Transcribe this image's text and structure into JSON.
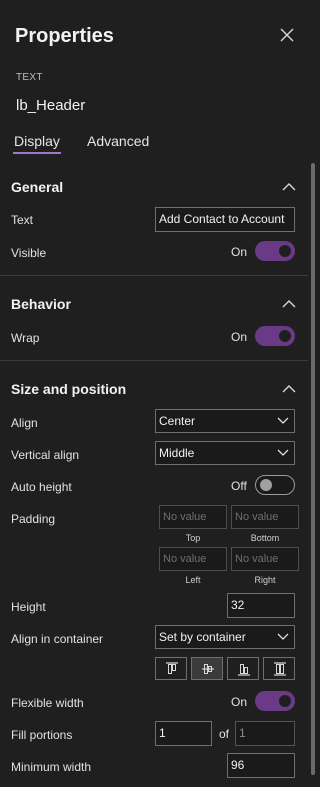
{
  "header": {
    "title": "Properties"
  },
  "control": {
    "type": "TEXT",
    "name": "lb_Header"
  },
  "tabs": [
    {
      "label": "Display"
    },
    {
      "label": "Advanced"
    }
  ],
  "sections": {
    "general": {
      "title": "General",
      "text_label": "Text",
      "text_value": "Add Contact to Account",
      "visible_label": "Visible",
      "visible_state": "On"
    },
    "behavior": {
      "title": "Behavior",
      "wrap_label": "Wrap",
      "wrap_state": "On"
    },
    "size_position": {
      "title": "Size and position",
      "align_label": "Align",
      "align_value": "Center",
      "valign_label": "Vertical align",
      "valign_value": "Middle",
      "autoheight_label": "Auto height",
      "autoheight_state": "Off",
      "padding_label": "Padding",
      "padding_placeholder": "No value",
      "padding_top": "Top",
      "padding_bottom": "Bottom",
      "padding_left": "Left",
      "padding_right": "Right",
      "height_label": "Height",
      "height_value": "32",
      "align_container_label": "Align in container",
      "align_container_value": "Set by container",
      "flexible_width_label": "Flexible width",
      "flexible_width_state": "On",
      "fill_portions_label": "Fill portions",
      "fill_portions_value": "1",
      "fill_portions_of": "of",
      "fill_portions_total": "1",
      "min_width_label": "Minimum width",
      "min_width_value": "96"
    }
  },
  "colors": {
    "background": "#1f1f1f",
    "accent": "#6b3a86",
    "tab_underline": "#a277c9"
  },
  "icons": {
    "close": "close-icon",
    "collapse": "chevron-up-icon",
    "dropdown": "chevron-down-icon",
    "align_start": "align-start-icon",
    "align_center": "align-center-icon",
    "align_end": "align-end-icon",
    "align_stretch": "align-stretch-icon"
  },
  "state": {
    "active_tab": "Display",
    "align_in_container_selected": "align-center"
  }
}
